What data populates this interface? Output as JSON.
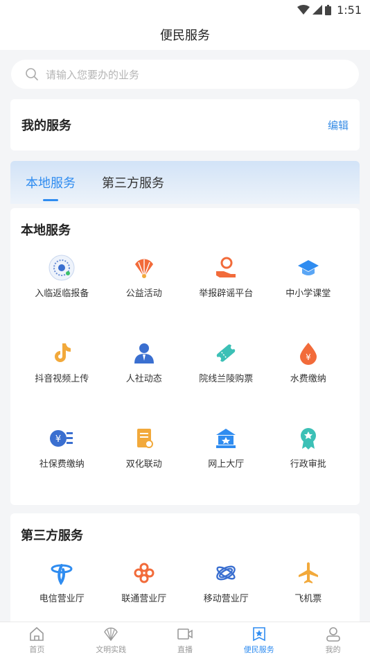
{
  "status_bar": {
    "time": "1:51"
  },
  "header": {
    "title": "便民服务"
  },
  "search": {
    "placeholder": "请输入您要办的业务"
  },
  "my_services": {
    "title": "我的服务",
    "edit_label": "编辑"
  },
  "tabs": [
    {
      "label": "本地服务",
      "active": true
    },
    {
      "label": "第三方服务",
      "active": false
    }
  ],
  "local_services": {
    "title": "本地服务",
    "items": [
      {
        "label": "入临返临报备",
        "icon": "qr-code-icon"
      },
      {
        "label": "公益活动",
        "icon": "fan-icon"
      },
      {
        "label": "举报辟谣平台",
        "icon": "report-hand-icon"
      },
      {
        "label": "中小学课堂",
        "icon": "graduation-cap-icon"
      },
      {
        "label": "抖音视频上传",
        "icon": "tiktok-icon"
      },
      {
        "label": "人社动态",
        "icon": "person-icon"
      },
      {
        "label": "院线兰陵购票",
        "icon": "ticket-icon"
      },
      {
        "label": "水费缴纳",
        "icon": "water-drop-icon"
      },
      {
        "label": "社保费缴纳",
        "icon": "social-security-icon"
      },
      {
        "label": "双化联动",
        "icon": "document-icon"
      },
      {
        "label": "网上大厅",
        "icon": "hall-icon"
      },
      {
        "label": "行政审批",
        "icon": "approval-badge-icon"
      }
    ]
  },
  "third_party_services": {
    "title": "第三方服务",
    "items": [
      {
        "label": "电信营业厅",
        "icon": "telecom-icon"
      },
      {
        "label": "联通营业厅",
        "icon": "unicom-icon"
      },
      {
        "label": "移动营业厅",
        "icon": "mobile-icon"
      },
      {
        "label": "飞机票",
        "icon": "airplane-icon"
      }
    ]
  },
  "bottom_nav": [
    {
      "label": "首页",
      "icon": "home-icon"
    },
    {
      "label": "文明实践",
      "icon": "fan-logo-icon"
    },
    {
      "label": "直播",
      "icon": "video-camera-icon"
    },
    {
      "label": "便民服务",
      "icon": "star-bookmark-icon",
      "active": true
    },
    {
      "label": "我的",
      "icon": "user-icon"
    }
  ],
  "colors": {
    "accent": "#2f8cf0",
    "orange": "#f26b3a",
    "gold": "#f2a93b"
  }
}
